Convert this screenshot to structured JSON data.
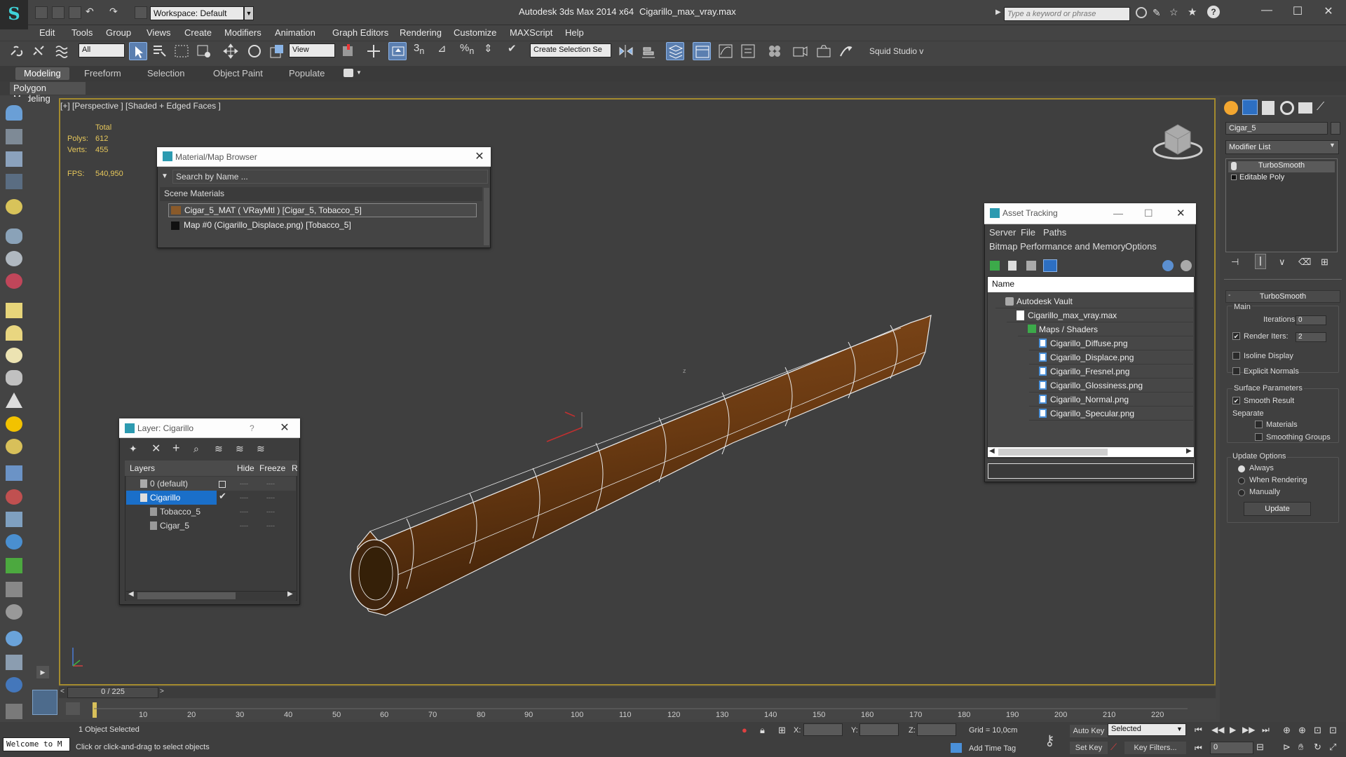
{
  "window": {
    "workspace": "Workspace: Default",
    "app_title": "Autodesk 3ds Max  2014 x64",
    "file_title": "Cigarillo_max_vray.max",
    "search_placeholder": "Type a keyword or phrase"
  },
  "menu": [
    "Edit",
    "Tools",
    "Group",
    "Views",
    "Create",
    "Modifiers",
    "Animation",
    "Graph Editors",
    "Rendering",
    "Customize",
    "MAXScript",
    "Help"
  ],
  "toolbar": {
    "selection_filter": "All",
    "ref_coord": "View",
    "named_selection": "Create Selection Se",
    "squid": "Squid Studio v"
  },
  "ribbon": {
    "tabs": [
      "Modeling",
      "Freeform",
      "Selection",
      "Object Paint",
      "Populate"
    ],
    "active_tab": "Modeling",
    "subpanel": "Polygon Modeling"
  },
  "viewport": {
    "label": "[+] [Perspective ] [Shaded + Edged Faces ]",
    "stats": {
      "total": "Total",
      "polys_label": "Polys:",
      "polys": "612",
      "verts_label": "Verts:",
      "verts": "455",
      "fps_label": "FPS:",
      "fps": "540,950"
    },
    "gizmo_z": "z"
  },
  "material_browser": {
    "title": "Material/Map Browser",
    "search": "Search by Name ...",
    "section": "Scene Materials",
    "items": [
      "Cigar_5_MAT  ( VRayMtl )  [Cigar_5, Tobacco_5]",
      "Map #0 (Cigarillo_Displace.png) [Tobacco_5]"
    ]
  },
  "layer_panel": {
    "title": "Layer: Cigarillo",
    "help": "?",
    "columns": [
      "Layers",
      "Hide",
      "Freeze",
      "R"
    ],
    "rows": [
      {
        "name": "0 (default)",
        "hide": "----",
        "freeze": "----"
      },
      {
        "name": "Cigarillo",
        "hide": "----",
        "freeze": "----"
      },
      {
        "name": "Tobacco_5",
        "hide": "----",
        "freeze": "----"
      },
      {
        "name": "Cigar_5",
        "hide": "----",
        "freeze": "----"
      }
    ]
  },
  "asset_tracking": {
    "title": "Asset Tracking",
    "menu": [
      "Server",
      "File",
      "Paths"
    ],
    "menu2": [
      "Bitmap Performance and Memory",
      "Options"
    ],
    "column": "Name",
    "rows": [
      "Autodesk Vault",
      "Cigarillo_max_vray.max",
      "Maps / Shaders",
      "Cigarillo_Diffuse.png",
      "Cigarillo_Displace.png",
      "Cigarillo_Fresnel.png",
      "Cigarillo_Glossiness.png",
      "Cigarillo_Normal.png",
      "Cigarillo_Specular.png"
    ]
  },
  "command_panel": {
    "object_name": "Cigar_5",
    "modifier_list": "Modifier List",
    "stack": [
      "TurboSmooth",
      "Editable Poly"
    ],
    "rollout": "TurboSmooth",
    "main": "Main",
    "iterations_label": "Iterations:",
    "iterations": "0",
    "render_iters_label": "Render Iters:",
    "render_iters": "2",
    "isoline": "Isoline Display",
    "explicit": "Explicit Normals",
    "surface": "Surface Parameters",
    "smooth_result": "Smooth Result",
    "separate": "Separate",
    "materials": "Materials",
    "smoothing_groups": "Smoothing Groups",
    "update_options": "Update Options",
    "always": "Always",
    "when_rendering": "When Rendering",
    "manually": "Manually",
    "update": "Update"
  },
  "timeline": {
    "frame": "0 / 225",
    "ticks": [
      "10",
      "20",
      "30",
      "40",
      "50",
      "60",
      "70",
      "80",
      "90",
      "100",
      "110",
      "120",
      "130",
      "140",
      "150",
      "160",
      "170",
      "180",
      "190",
      "200",
      "210",
      "220"
    ]
  },
  "status": {
    "welcome": "Welcome to M",
    "selected": "1 Object Selected",
    "prompt": "Click or click-and-drag to select objects",
    "x_label": "X:",
    "y_label": "Y:",
    "z_label": "Z:",
    "grid": "Grid = 10,0cm",
    "add_time_tag": "Add Time Tag",
    "auto_key": "Auto Key",
    "set_key": "Set Key",
    "selected_dd": "Selected",
    "key_filters": "Key Filters...",
    "frame_field": "0"
  }
}
